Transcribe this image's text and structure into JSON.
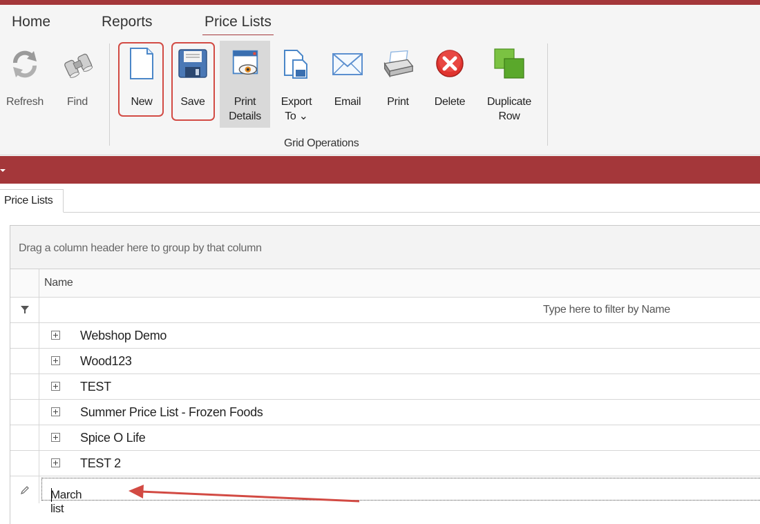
{
  "colors": {
    "accent": "#a4373a",
    "highlight_box": "#d24a43",
    "arrow": "#d24a43"
  },
  "menu": {
    "tabs": [
      {
        "label": "Home"
      },
      {
        "label": "Reports"
      },
      {
        "label": "Price Lists",
        "active": true
      }
    ]
  },
  "ribbon": {
    "buttons": [
      {
        "label": "Refresh",
        "icon": "refresh-icon",
        "enabled": false
      },
      {
        "label": "Find",
        "icon": "binoculars-icon",
        "enabled": false
      },
      {
        "label": "New",
        "icon": "new-document-icon",
        "highlighted": true
      },
      {
        "label": "Save",
        "icon": "floppy-disk-icon",
        "highlighted": true
      },
      {
        "label": "Print\nDetails",
        "icon": "print-preview-icon",
        "pressed": true
      },
      {
        "label": "Export\nTo ⌄",
        "icon": "export-icon"
      },
      {
        "label": "Email",
        "icon": "envelope-icon"
      },
      {
        "label": "Print",
        "icon": "printer-icon"
      },
      {
        "label": "Delete",
        "icon": "delete-icon"
      },
      {
        "label": "Duplicate\nRow",
        "icon": "duplicate-icon"
      }
    ],
    "group_label": "Grid Operations"
  },
  "document_tab": {
    "label": "Price Lists"
  },
  "grid": {
    "group_panel_text": "Drag a column header here to group by that column",
    "column_header": "Name",
    "filter_placeholder": "Type here to filter by Name",
    "rows": [
      {
        "name": "Webshop Demo"
      },
      {
        "name": "Wood123"
      },
      {
        "name": "TEST"
      },
      {
        "name": "Summer Price List - Frozen Foods"
      },
      {
        "name": "Spice O Life"
      },
      {
        "name": "TEST 2"
      }
    ],
    "new_row_value": "March list"
  }
}
